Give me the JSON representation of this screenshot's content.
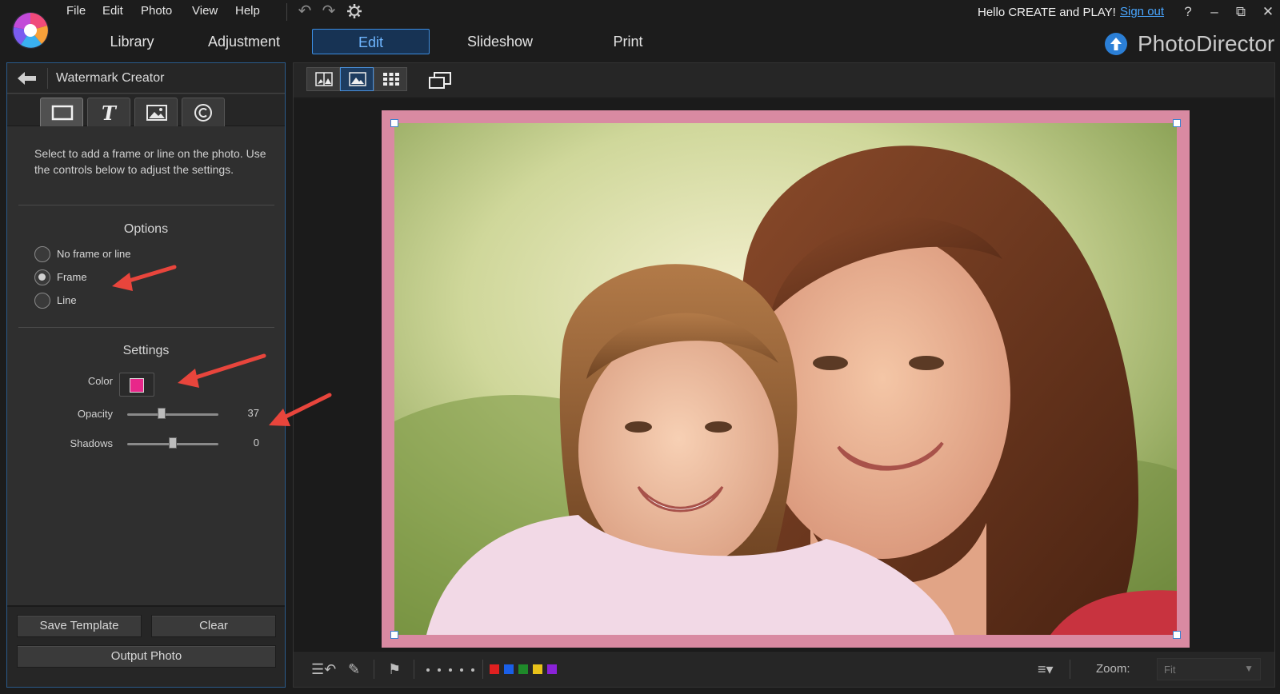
{
  "menu": {
    "file": "File",
    "edit": "Edit",
    "photo": "Photo",
    "view": "View",
    "help": "Help"
  },
  "header": {
    "greeting": "Hello CREATE and PLAY!",
    "sign_out": "Sign out",
    "help_glyph": "?",
    "brand_name": "PhotoDirector"
  },
  "tabs": [
    {
      "label": "Library"
    },
    {
      "label": "Adjustment"
    },
    {
      "label": "Edit",
      "active": true
    },
    {
      "label": "Slideshow"
    },
    {
      "label": "Print"
    }
  ],
  "panel": {
    "title": "Watermark Creator",
    "type_tabs": [
      "frame-icon",
      "text-icon",
      "image-icon",
      "copyright-icon"
    ],
    "description": "Select to add a frame or line on the photo. Use the controls below to adjust the settings.",
    "options": {
      "title": "Options",
      "items": [
        {
          "label": "No frame or line",
          "checked": false
        },
        {
          "label": "Frame",
          "checked": true
        },
        {
          "label": "Line",
          "checked": false
        }
      ]
    },
    "settings": {
      "title": "Settings",
      "color_label": "Color",
      "color_value": "#e8278a",
      "opacity_label": "Opacity",
      "opacity_value": "37",
      "shadows_label": "Shadows",
      "shadows_value": "0"
    },
    "buttons": {
      "save_template": "Save Template",
      "clear": "Clear",
      "output_photo": "Output Photo"
    }
  },
  "viewer": {
    "view_modes": [
      "compare-view-icon",
      "single-view-icon",
      "grid-view-icon"
    ],
    "frame_color": "#d98aa2",
    "rating_colors": [
      "#e02020",
      "#1a5fe8",
      "#1f8a2a",
      "#e8c21a",
      "#8a22d8"
    ],
    "zoom_label": "Zoom:",
    "zoom_value": "Fit"
  },
  "colors": {
    "accent": "#3c8de0",
    "link": "#49a6ff",
    "annotation_arrow": "#e8453c"
  }
}
